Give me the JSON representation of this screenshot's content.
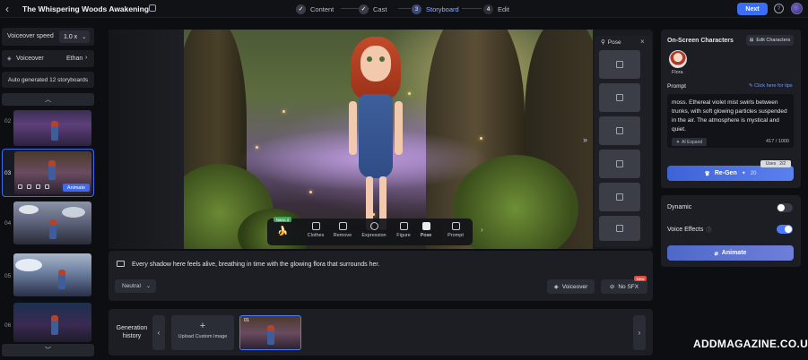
{
  "header": {
    "back_icon": "chevron-left-icon",
    "title": "The Whispering Woods Awakening",
    "steps": [
      {
        "num": "✓",
        "label": "Content",
        "state": "done"
      },
      {
        "num": "✓",
        "label": "Cast",
        "state": "done"
      },
      {
        "num": "3",
        "label": "Storyboard",
        "state": "active"
      },
      {
        "num": "4",
        "label": "Edit",
        "state": "todo"
      }
    ],
    "next_label": "Next",
    "accent": "#3b6ef5"
  },
  "sidebar": {
    "voiceover_speed_label": "Voiceover speed",
    "voiceover_speed_value": "1.0 x",
    "voiceover_label": "Voiceover",
    "voiceover_value": "Ethan",
    "auto_generated": "Auto generated 12 storyboards",
    "storyboards": [
      {
        "num": "02"
      },
      {
        "num": "03",
        "selected": true,
        "badge": "Animate"
      },
      {
        "num": "04"
      },
      {
        "num": "05"
      },
      {
        "num": "06"
      }
    ]
  },
  "pose_panel": {
    "title": "Pose",
    "card_count": 6
  },
  "toolbar": {
    "name_badge": "Nano 2",
    "tools": [
      {
        "label": "Clothes"
      },
      {
        "label": "Remove"
      },
      {
        "label": "Expression"
      },
      {
        "label": "Figure"
      },
      {
        "label": "Pose",
        "active": true
      },
      {
        "label": "Prompt"
      }
    ]
  },
  "caption": {
    "text": "Every shadow here feels alive, breathing in time with the glowing flora that surrounds her.",
    "emotion": "Neutral",
    "voiceover_btn": "Voiceover",
    "sfx_btn": "No SFX",
    "new_badge": "New"
  },
  "generation_history": {
    "label": "Generation history",
    "upload_label": "Upload Custom Image",
    "items": [
      {
        "num": "01"
      }
    ]
  },
  "right_panel": {
    "onscreen_title": "On-Screen Characters",
    "edit_characters": "Edit Characters",
    "character_name": "Flora",
    "prompt_label": "Prompt",
    "tips_link": "✎ Click here for tips",
    "prompt_text": "moss. Ethereal violet mist swirls between trunks, with soft glowing particles suspended in the air. The atmosphere is mystical and quiet.",
    "ai_expand": "AI Expand",
    "char_count": "417 / 1000",
    "uses_label": "Uses",
    "uses_value": "2/2",
    "regen_label": "Re-Gen",
    "regen_cost": "20",
    "dynamic_label": "Dynamic",
    "dynamic_on": false,
    "voice_effects_label": "Voice Effects",
    "voice_effects_on": true,
    "animate_label": "Animate"
  },
  "watermark": "ADDMAGAZINE.CO.UK"
}
